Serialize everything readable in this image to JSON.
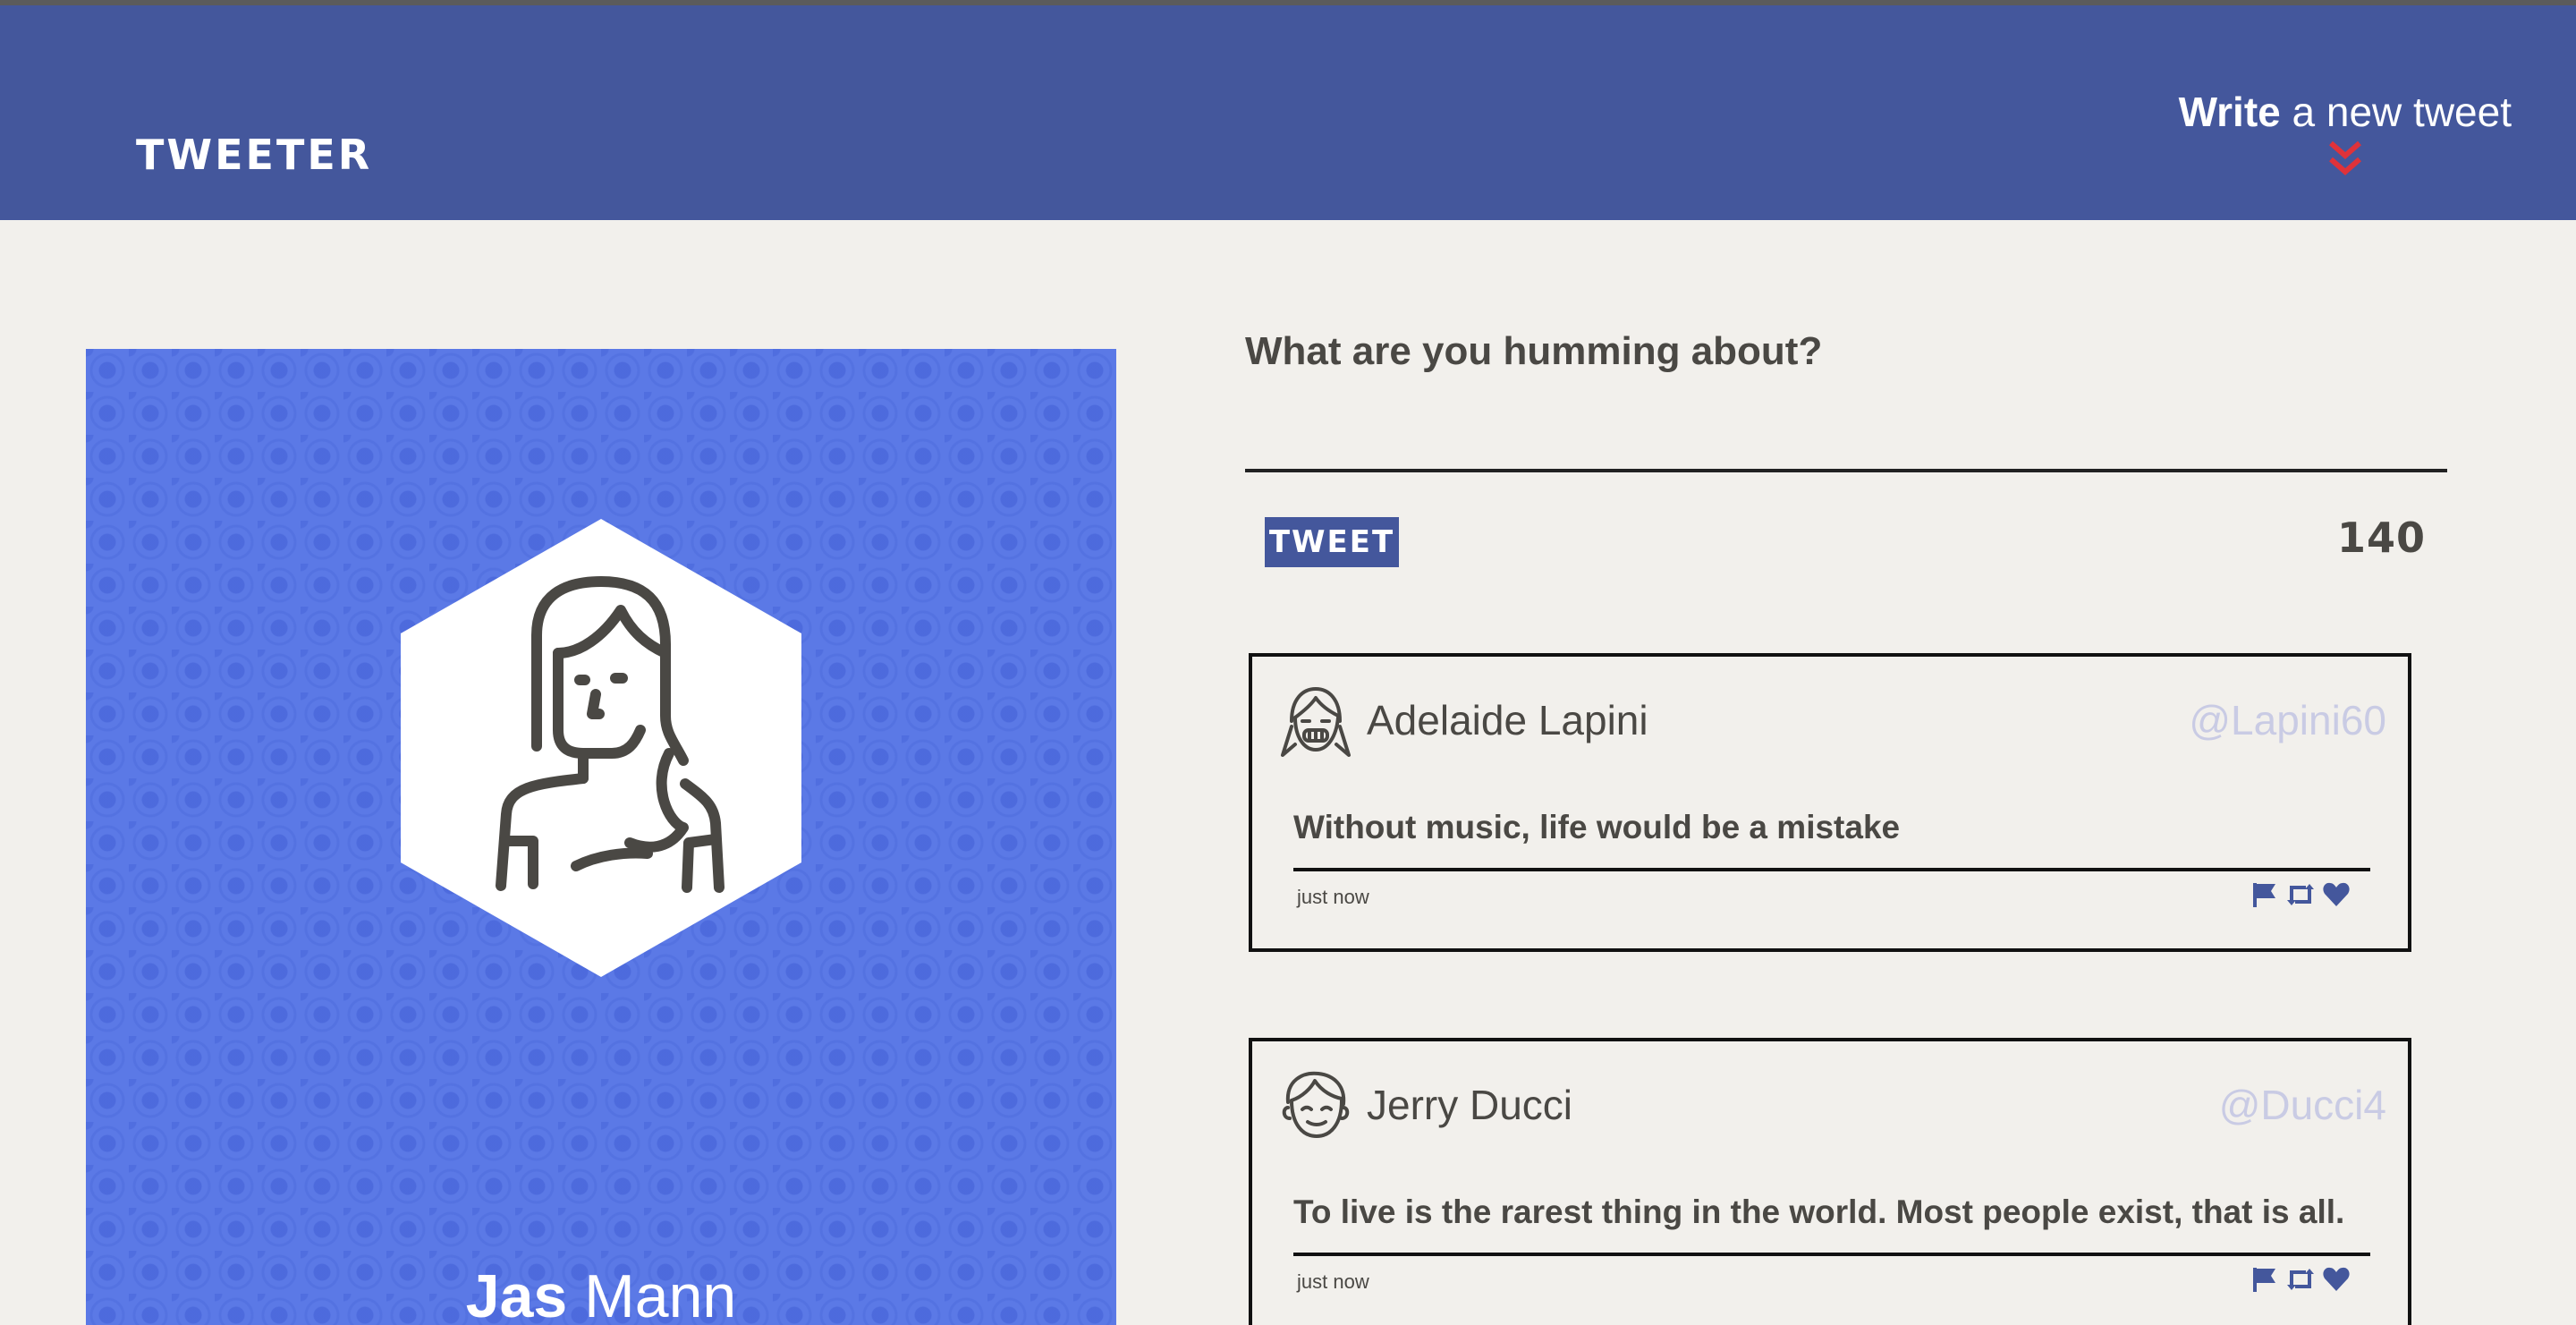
{
  "header": {
    "logo": "TWEETER",
    "compose_bold": "Write",
    "compose_rest": "a new tweet"
  },
  "profile": {
    "first_name": "Jas",
    "last_name": "Mann"
  },
  "composer": {
    "question": "What are you humming about?",
    "input_value": "",
    "button_label": "TWEET",
    "counter": "140"
  },
  "tweets": [
    {
      "name": "Adelaide Lapini",
      "handle": "@Lapini60",
      "text": "Without music, life would be a mistake",
      "time": "just now"
    },
    {
      "name": "Jerry Ducci",
      "handle": "@Ducci4",
      "text": "To live is the rarest thing in the world. Most people exist, that is all.",
      "time": "just now"
    }
  ],
  "colors": {
    "header_bg": "#44579c",
    "page_bg": "#f2f0ec",
    "profile_bg": "#5b79e6",
    "accent_red": "#e0323a",
    "handle_color": "#c9cbe4",
    "icon_color": "#44579c"
  },
  "icons": [
    "double-chevron-down-icon",
    "flag-icon",
    "retweet-icon",
    "heart-icon"
  ]
}
